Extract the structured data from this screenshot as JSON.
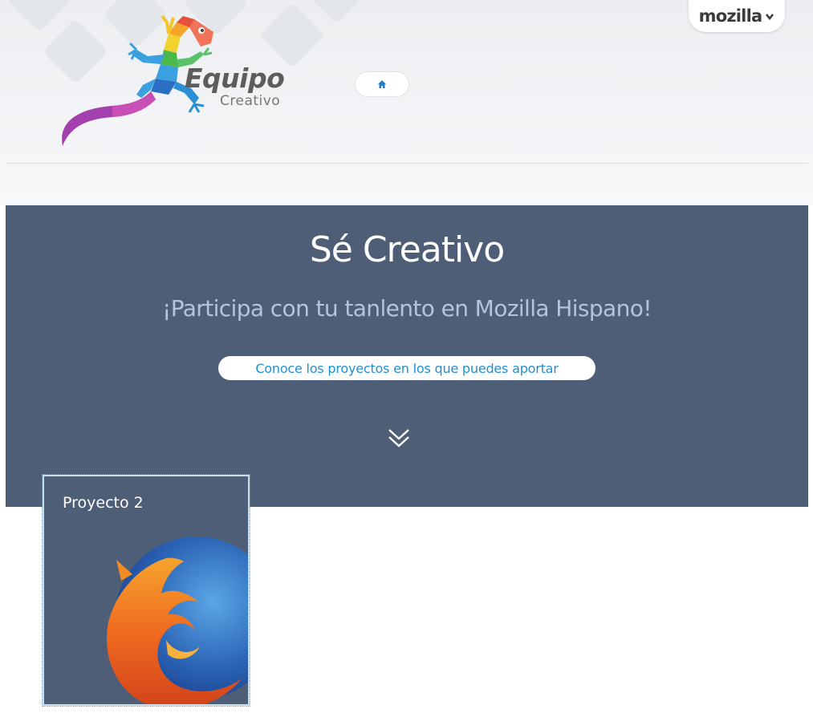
{
  "header": {
    "logo_title": "Equipo",
    "logo_subtitle": "Creativo",
    "home_icon": "home-icon",
    "mozilla_label": "mozilla",
    "mozilla_menu_icon": "chevron-down-icon"
  },
  "hero": {
    "title": "Sé Creativo",
    "subtitle": "¡Participa con tu tanlento en Mozilla Hispano!",
    "cta_label": "Conoce los proyectos en los que puedes aportar",
    "scroll_icon": "double-chevron-down-icon"
  },
  "projects": [
    {
      "title": "Proyecto 2",
      "image": "firefox-logo"
    }
  ],
  "colors": {
    "hero_background": "#4f5e77",
    "accent_link": "#1e90d6",
    "subtitle": "#b5c4d8"
  }
}
